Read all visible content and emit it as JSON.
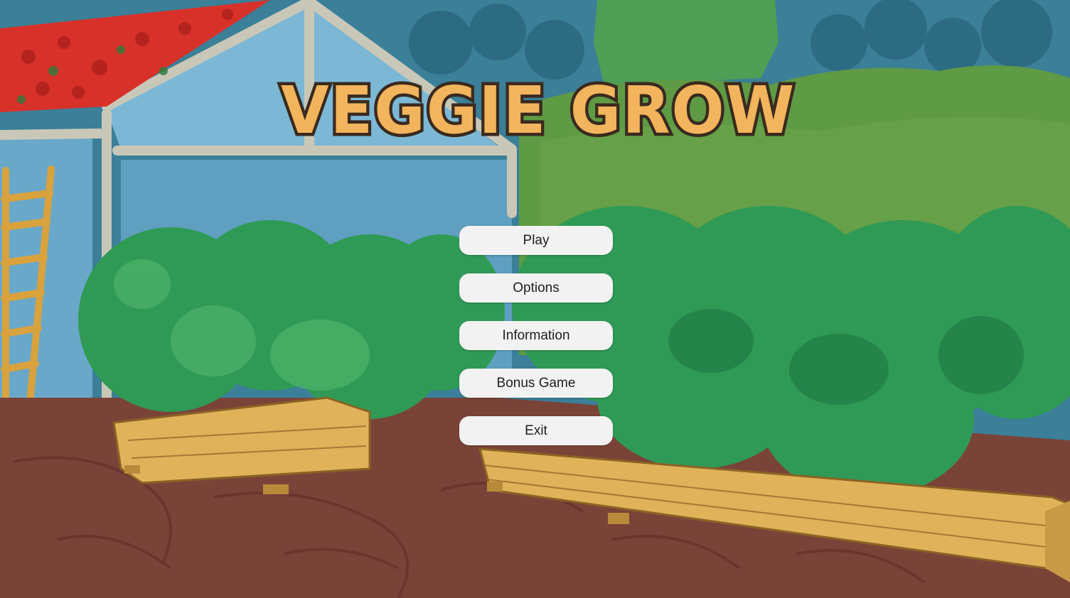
{
  "game": {
    "title": "VEGGIE GROW"
  },
  "menu": {
    "items": [
      {
        "id": "play",
        "label": "Play"
      },
      {
        "id": "options",
        "label": "Options"
      },
      {
        "id": "information",
        "label": "Information"
      },
      {
        "id": "bonus-game",
        "label": "Bonus Game"
      },
      {
        "id": "exit",
        "label": "Exit"
      }
    ]
  },
  "colors": {
    "title_fill": "#f2b45c",
    "title_outline": "#3a2a1f",
    "button_bg": "#f2f2f2",
    "button_text": "#1e1e1e",
    "sky": "#3b7f98",
    "floor": "#7a4338",
    "foliage": "#2f9a55",
    "planter_wood": "#e0b25a",
    "roof_red": "#d8312a"
  }
}
